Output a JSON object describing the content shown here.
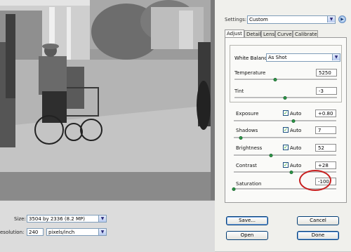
{
  "settings": {
    "label": "Settings:",
    "value": "Custom"
  },
  "tabs": [
    {
      "label": "Adjust",
      "active": true
    },
    {
      "label": "Detail",
      "active": false
    },
    {
      "label": "Lens",
      "active": false
    },
    {
      "label": "Curve",
      "active": false
    },
    {
      "label": "Calibrate",
      "active": false
    }
  ],
  "white_balance": {
    "label": "White Balance:",
    "value": "As Shot"
  },
  "controls": {
    "temperature": {
      "label": "Temperature",
      "value": "5250",
      "slider_fraction": 0.4
    },
    "tint": {
      "label": "Tint",
      "value": "-3",
      "slider_fraction": 0.49
    },
    "exposure": {
      "label": "Exposure",
      "value": "+0.80",
      "auto_checked": true,
      "auto_label": "Auto",
      "slider_fraction": 0.58
    },
    "shadows": {
      "label": "Shadows",
      "value": "7",
      "auto_checked": true,
      "auto_label": "Auto",
      "slider_fraction": 0.07
    },
    "brightness": {
      "label": "Brightness",
      "value": "52",
      "auto_checked": true,
      "auto_label": "Auto",
      "slider_fraction": 0.36
    },
    "contrast": {
      "label": "Contrast",
      "value": "+28",
      "auto_checked": true,
      "auto_label": "Auto",
      "slider_fraction": 0.56
    },
    "saturation": {
      "label": "Saturation",
      "value": "-100",
      "slider_fraction": 0.0
    }
  },
  "image_options": {
    "size_label": "Size:",
    "size_value": "3504 by 2336  (8.2 MP)",
    "resolution_label": "esolution:",
    "resolution_value": "240",
    "resolution_unit": "pixels/inch"
  },
  "buttons": {
    "save": "Save...",
    "cancel": "Cancel",
    "open": "Open",
    "done": "Done"
  },
  "colors": {
    "highlight": "#c81e1e",
    "slider_thumb": "#2e9a4a",
    "panel_bg": "#f0f0ec"
  },
  "icons": {
    "settings_menu": "circle-arrow-icon",
    "dropdown": "chevron-down-icon",
    "check": "check-icon"
  }
}
